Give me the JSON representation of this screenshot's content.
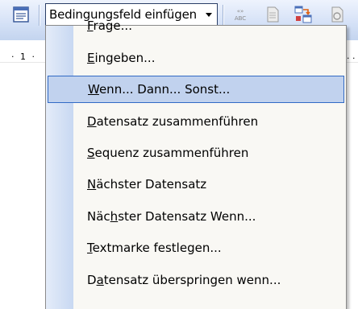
{
  "toolbar": {
    "dropdown_label": "Bedingungsfeld einfügen",
    "icons": [
      "document-icon",
      "merge-field-abc-icon",
      "page-icon",
      "insert-merge-icon",
      "refresh-icon"
    ]
  },
  "ruler": {
    "left_text": "· 1 ·",
    "right_text": "· ·"
  },
  "menu": {
    "items": [
      {
        "pre": "",
        "key": "F",
        "post": "rage...",
        "selected": false
      },
      {
        "pre": "",
        "key": "E",
        "post": "ingeben...",
        "selected": false
      },
      {
        "pre": "",
        "key": "W",
        "post": "enn... Dann... Sonst...",
        "selected": true
      },
      {
        "pre": "",
        "key": "D",
        "post": "atensatz zusammenführen",
        "selected": false
      },
      {
        "pre": "",
        "key": "S",
        "post": "equenz zusammenführen",
        "selected": false
      },
      {
        "pre": "",
        "key": "N",
        "post": "ächster Datensatz",
        "selected": false
      },
      {
        "pre": "Näc",
        "key": "h",
        "post": "ster Datensatz Wenn...",
        "selected": false
      },
      {
        "pre": "",
        "key": "T",
        "post": "extmarke festlegen...",
        "selected": false
      },
      {
        "pre": "D",
        "key": "a",
        "post": "tensatz überspringen wenn...",
        "selected": false
      }
    ]
  },
  "colors": {
    "selection_fill": "#c1d2ee",
    "selection_border": "#316ac5",
    "toolbar_top": "#eef3fd",
    "toolbar_bottom": "#c3d4ef"
  }
}
